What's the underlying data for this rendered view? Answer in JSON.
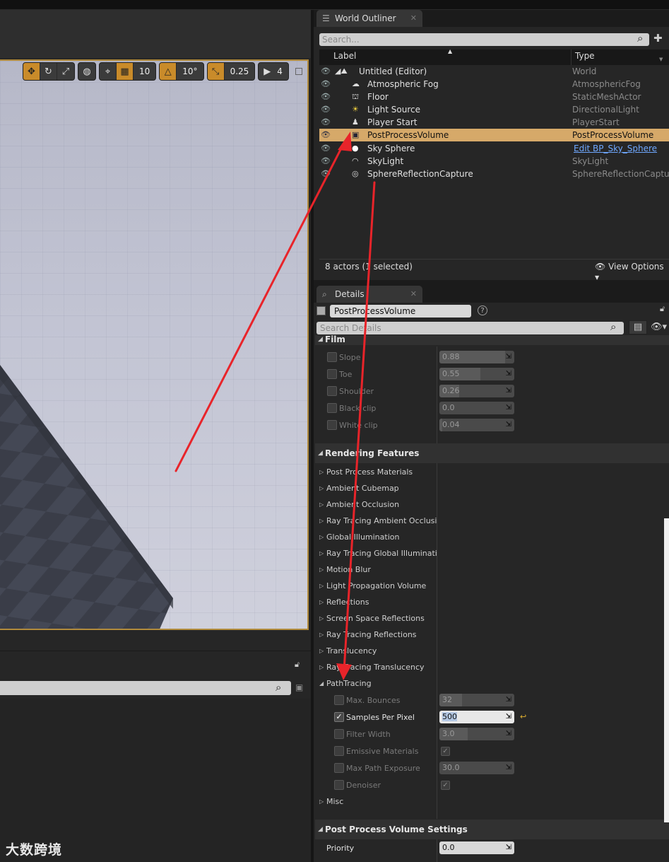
{
  "viewport": {
    "toolbar": {
      "grid_snap": "10",
      "rotation_snap": "10°",
      "scale_snap": "0.25",
      "camera_speed": "4"
    }
  },
  "outliner": {
    "tab_title": "World Outliner",
    "search_placeholder": "Search...",
    "col_label": "Label",
    "col_type": "Type",
    "rows": [
      {
        "label": "Untitled (Editor)",
        "type": "World"
      },
      {
        "label": "Atmospheric Fog",
        "type": "AtmosphericFog"
      },
      {
        "label": "Floor",
        "type": "StaticMeshActor"
      },
      {
        "label": "Light Source",
        "type": "DirectionalLight"
      },
      {
        "label": "Player Start",
        "type": "PlayerStart"
      },
      {
        "label": "PostProcessVolume",
        "type": "PostProcessVolume"
      },
      {
        "label": "Sky Sphere",
        "type": "Edit BP_Sky_Sphere"
      },
      {
        "label": "SkyLight",
        "type": "SkyLight"
      },
      {
        "label": "SphereReflectionCapture",
        "type": "SphereReflectionCapture"
      }
    ],
    "actor_count": "8 actors (1 selected)",
    "view_options": "View Options"
  },
  "details": {
    "tab_title": "Details",
    "object_name": "PostProcessVolume",
    "search_placeholder": "Search Details",
    "film": {
      "title": "Film",
      "props": [
        {
          "label": "Slope",
          "value": "0.88",
          "fill": 0.88
        },
        {
          "label": "Toe",
          "value": "0.55",
          "fill": 0.55
        },
        {
          "label": "Shoulder",
          "value": "0.26",
          "fill": 0.26
        },
        {
          "label": "Black clip",
          "value": "0.0",
          "fill": 0.0
        },
        {
          "label": "White clip",
          "value": "0.04",
          "fill": 0.04
        }
      ]
    },
    "rendering": {
      "title": "Rendering Features",
      "items": [
        "Post Process Materials",
        "Ambient Cubemap",
        "Ambient Occlusion",
        "Ray Tracing Ambient Occlusion",
        "Global Illumination",
        "Ray Tracing Global Illumination",
        "Motion Blur",
        "Light Propagation Volume",
        "Reflections",
        "Screen Space Reflections",
        "Ray Tracing Reflections",
        "Translucency",
        "Ray Tracing Translucency"
      ]
    },
    "pathtracing": {
      "title": "PathTracing",
      "max_bounces": {
        "label": "Max. Bounces",
        "value": "32"
      },
      "samples_per_pixel": {
        "label": "Samples Per Pixel",
        "value": "500"
      },
      "filter_width": {
        "label": "Filter Width",
        "value": "3.0"
      },
      "emissive_materials": {
        "label": "Emissive Materials"
      },
      "max_path_exposure": {
        "label": "Max Path Exposure",
        "value": "30.0"
      },
      "denoiser": {
        "label": "Denoiser"
      }
    },
    "misc": {
      "title": "Misc"
    },
    "ppv_settings": {
      "title": "Post Process Volume Settings",
      "priority": {
        "label": "Priority",
        "value": "0.0"
      }
    }
  },
  "watermark": "大数跨境",
  "colors": {
    "selection": "#d6a969",
    "viewport_border": "#b28b3c",
    "annotation_arrow": "#e8242a",
    "link": "#6fa8ff"
  }
}
